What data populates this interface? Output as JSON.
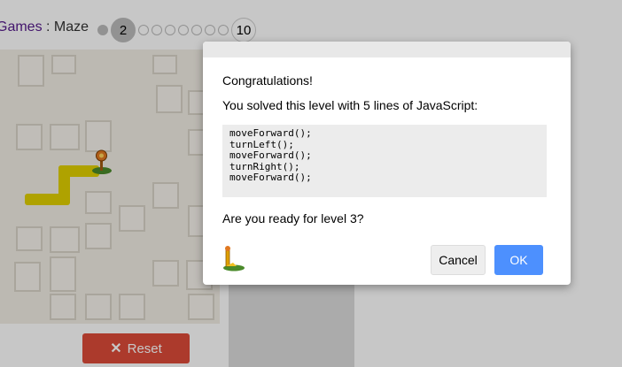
{
  "header": {
    "games_label": "Games",
    "separator": " : ",
    "game_name": "Maze",
    "levels": [
      "1",
      "2",
      "3",
      "4",
      "5",
      "6",
      "7",
      "8",
      "9",
      "10"
    ],
    "current_level_label": "2",
    "last_level_label": "10"
  },
  "maze": {
    "path_color": "#e0d000"
  },
  "reset_button": {
    "icon": "close-icon",
    "label": "Reset"
  },
  "dialog": {
    "heading": "Congratulations!",
    "message": "You solved this level with 5 lines of JavaScript:",
    "code_lines": [
      "moveForward();",
      "turnLeft();",
      "moveForward();",
      "turnRight();",
      "moveForward();"
    ],
    "question": "Are you ready for level 3?",
    "cancel_label": "Cancel",
    "ok_label": "OK"
  },
  "colors": {
    "accent_blue": "#4d90fe",
    "reset_red": "#dd4b39",
    "link_purple": "#551a8b"
  }
}
